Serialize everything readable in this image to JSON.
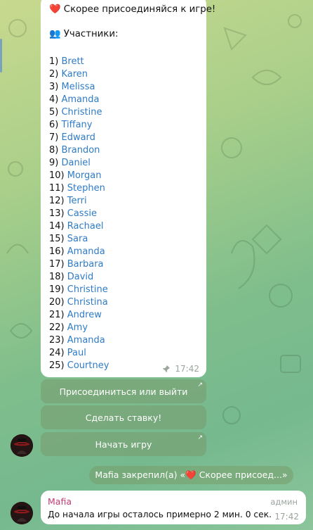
{
  "pinned_message": {
    "title": "❤️ Скорее присоединяйся к игре!",
    "participants_label": "👥 Участники:",
    "participants": [
      {
        "num": "1)",
        "name": "Brett"
      },
      {
        "num": "2)",
        "name": "Karen"
      },
      {
        "num": "3)",
        "name": "Melissa"
      },
      {
        "num": "4)",
        "name": "Amanda"
      },
      {
        "num": "5)",
        "name": "Christine"
      },
      {
        "num": "6)",
        "name": "Tiffany"
      },
      {
        "num": "7)",
        "name": "Edward"
      },
      {
        "num": "8)",
        "name": "Brandon"
      },
      {
        "num": "9)",
        "name": "Daniel"
      },
      {
        "num": "10)",
        "name": "Morgan"
      },
      {
        "num": "11)",
        "name": "Stephen"
      },
      {
        "num": "12)",
        "name": "Terri"
      },
      {
        "num": "13)",
        "name": "Cassie"
      },
      {
        "num": "14)",
        "name": "Rachael"
      },
      {
        "num": "15)",
        "name": "Sara"
      },
      {
        "num": "16)",
        "name": "Amanda"
      },
      {
        "num": "17)",
        "name": "Barbara"
      },
      {
        "num": "18)",
        "name": "David"
      },
      {
        "num": "19)",
        "name": "Christine"
      },
      {
        "num": "20)",
        "name": "Christina"
      },
      {
        "num": "21)",
        "name": "Andrew"
      },
      {
        "num": "22)",
        "name": "Amy"
      },
      {
        "num": "23)",
        "name": "Amanda"
      },
      {
        "num": "24)",
        "name": "Paul"
      },
      {
        "num": "25)",
        "name": "Courtney"
      }
    ],
    "time": "17:42",
    "pin_icon": "pin-icon"
  },
  "inline_keyboard": {
    "join_leave": "Присоединиться или выйти",
    "place_bet": "Сделать ставку!",
    "start_game": "Начать игру"
  },
  "service_message": "Mafia закрепил(а) «❤️ Скорее присоед...»",
  "last_message": {
    "author": "Mafia",
    "badge": "админ",
    "text": "До начала игры осталось примерно 2 мин. 0 сек.",
    "time": "17:42"
  },
  "colors": {
    "link": "#2e7cc7",
    "author": "#c43a72",
    "keyboard_bg": "#789b6e"
  }
}
